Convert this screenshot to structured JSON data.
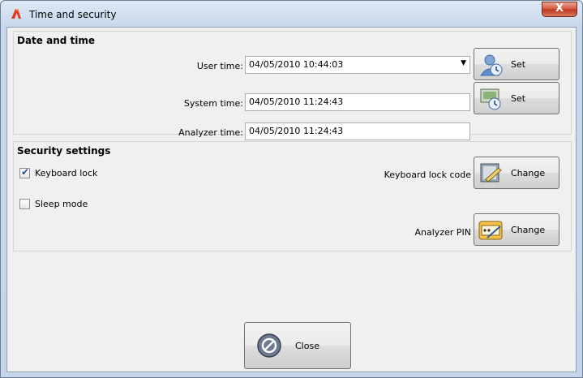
{
  "window": {
    "title": "Time and security",
    "close_glyph": "X",
    "app_icon": "app-logo-icon"
  },
  "date_time": {
    "heading": "Date and time",
    "user_time": {
      "label": "User time:",
      "value": "04/05/2010 10:44:03",
      "button": "Set",
      "icon": "user-clock-icon"
    },
    "system_time": {
      "label": "System time:",
      "value": "04/05/2010 11:24:43",
      "button": "Set",
      "icon": "computer-clock-icon"
    },
    "analyzer_time": {
      "label": "Analyzer time:",
      "value": "04/05/2010 11:24:43"
    }
  },
  "security": {
    "heading": "Security settings",
    "keyboard_lock": {
      "label": "Keyboard lock",
      "checked": true
    },
    "sleep_mode": {
      "label": "Sleep mode",
      "checked": false
    },
    "keyboard_lock_code": {
      "label": "Keyboard lock code",
      "button": "Change",
      "icon": "keyboard-lock-icon"
    },
    "analyzer_pin": {
      "label": "Analyzer PIN",
      "button": "Change",
      "icon": "pin-keypad-icon"
    }
  },
  "footer": {
    "close_button": "Close",
    "close_icon": "close-circle-icon"
  },
  "colors": {
    "title_gradient": "#c9d9ec",
    "close_red": "#c0331d",
    "client_bg": "#f0f0f0"
  }
}
